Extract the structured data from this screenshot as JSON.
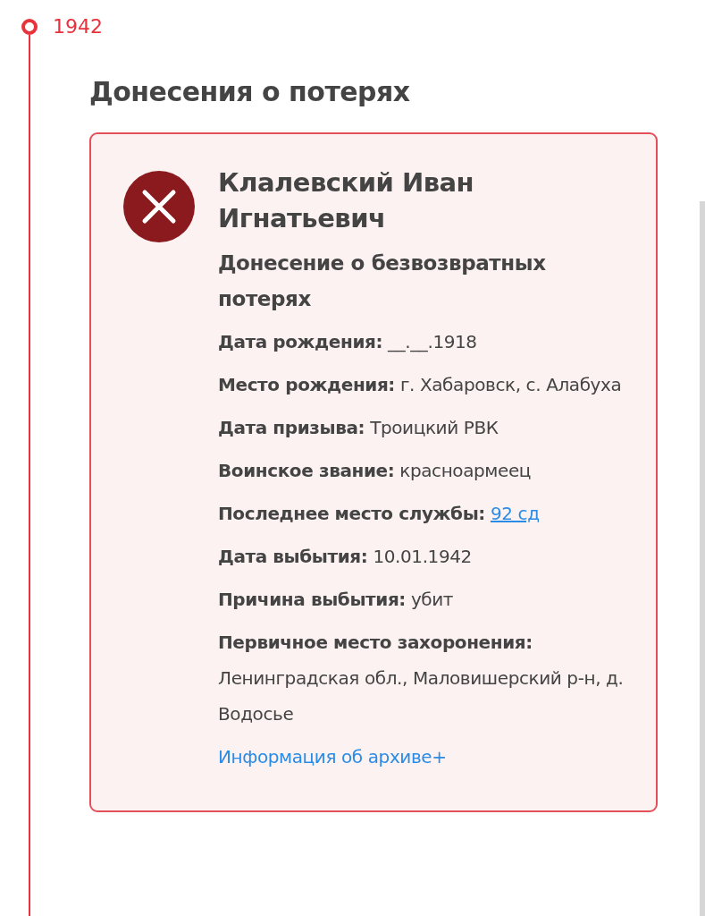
{
  "timeline": {
    "year": "1942"
  },
  "section": {
    "title": "Донесения о потерях"
  },
  "card": {
    "error": true,
    "name": "Клалевский Иван Игнатьевич",
    "document": "Донесение о безвозвратных потерях",
    "fields": [
      {
        "label": "Дата рождения:",
        "value": "__.__.1918",
        "kind": "text"
      },
      {
        "label": "Место рождения:",
        "value": "г. Хабаровск, с. Алабуха",
        "kind": "text"
      },
      {
        "label": "Дата призыва:",
        "value": "Троицкий РВК",
        "kind": "text"
      },
      {
        "label": "Воинское звание:",
        "value": "красноармеец",
        "kind": "text"
      },
      {
        "label": "Последнее место службы:",
        "value": "92 сд",
        "kind": "link"
      },
      {
        "label": "Дата выбытия:",
        "value": "10.01.1942",
        "kind": "text"
      },
      {
        "label": "Причина выбытия:",
        "value": "убит",
        "kind": "text"
      },
      {
        "label": "Первичное место захоронения:",
        "value": "Ленинградская обл., Маловишерский р-н, д. Водосье",
        "kind": "text"
      }
    ],
    "archive_link": "Информация об архиве+"
  }
}
